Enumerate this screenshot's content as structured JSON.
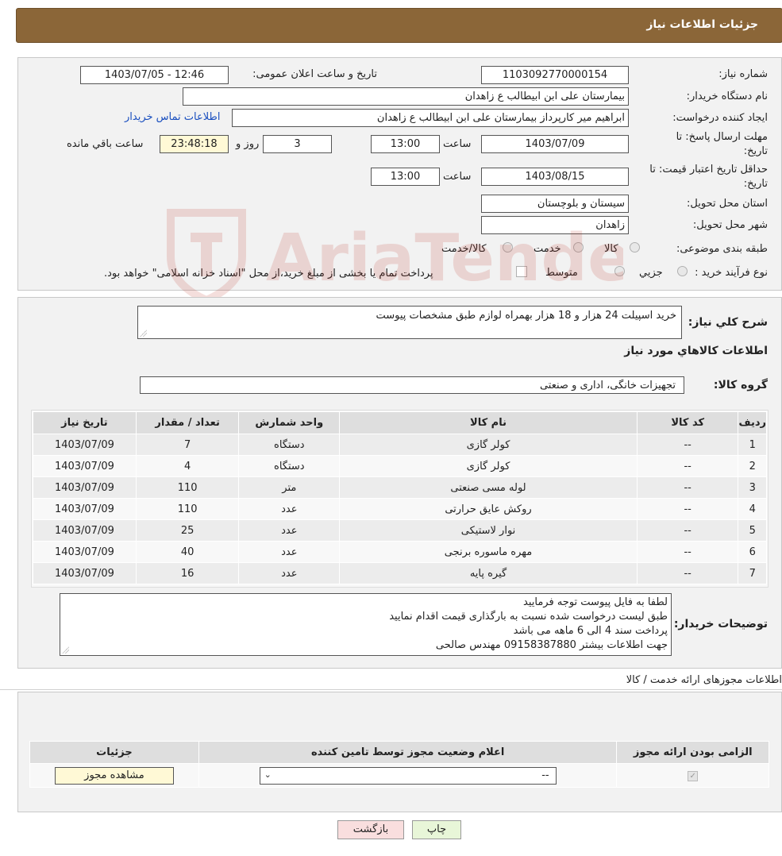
{
  "header": {
    "title": "جزئیات اطلاعات نیاز"
  },
  "need": {
    "number_label": "شماره نیاز:",
    "number_value": "1103092770000154",
    "announce_label": "تاریخ و ساعت اعلان عمومی:",
    "announce_value": "1403/07/05 - 12:46",
    "buyer_label": "نام دستگاه خریدار:",
    "buyer_value": "بیمارستان علی ابن ابیطالب  ع  زاهدان",
    "creator_label": "ایجاد کننده درخواست:",
    "creator_value": "ابراهیم میر کارپرداز بیمارستان علی ابن ابیطالب  ع  زاهدان",
    "contact_link": "اطلاعات تماس خریدار",
    "deadline_label_1": "مهلت ارسال پاسخ: تا",
    "deadline_label_2": "تاریخ:",
    "deadline_date": "1403/07/09",
    "time_label": "ساعت",
    "deadline_time": "13:00",
    "days_value": "3",
    "days_label": "روز و",
    "remaining_value": "23:48:18",
    "remaining_label": "ساعت باقي مانده",
    "validity_label_1": "حداقل تاریخ اعتبار قیمت: تا",
    "validity_label_2": "تاریخ:",
    "validity_date": "1403/08/15",
    "validity_time": "13:00",
    "province_label": "استان محل تحویل:",
    "province_value": "سیستان و بلوچستان",
    "city_label": "شهر محل تحویل:",
    "city_value": "زاهدان",
    "category_label": "طبقه بندی موضوعی:",
    "category_options": [
      "کالا",
      "خدمت",
      "کالا/خدمت"
    ],
    "process_label": "نوع فرآیند خرید :",
    "process_options": [
      "جزیي",
      "متوسط"
    ],
    "process_note": "پرداخت تمام یا بخشی از مبلغ خرید،از محل \"اسناد خزانه اسلامی\" خواهد بود."
  },
  "description": {
    "label": "شرح کلي نياز:",
    "value": "خرید اسپیلت 24 هزار و 18 هزار بهمراه لوازم طبق مشخصات پیوست"
  },
  "goods_title": "اطلاعات کالاهاي مورد نياز",
  "group": {
    "label": "گروه کالا:",
    "value": "تجهیزات خانگی، اداری و صنعتی"
  },
  "goods_table": {
    "headers": [
      "رديف",
      "کد کالا",
      "نام کالا",
      "واحد شمارش",
      "تعداد / مقدار",
      "تاریخ نیاز"
    ],
    "rows": [
      [
        "1",
        "--",
        "کولر گازی",
        "دستگاه",
        "7",
        "1403/07/09"
      ],
      [
        "2",
        "--",
        "کولر گازی",
        "دستگاه",
        "4",
        "1403/07/09"
      ],
      [
        "3",
        "--",
        "لوله مسی صنعتی",
        "متر",
        "110",
        "1403/07/09"
      ],
      [
        "4",
        "--",
        "روکش عایق حرارتی",
        "عدد",
        "110",
        "1403/07/09"
      ],
      [
        "5",
        "--",
        "نوار لاستیکی",
        "عدد",
        "25",
        "1403/07/09"
      ],
      [
        "6",
        "--",
        "مهره ماسوره برنجی",
        "عدد",
        "40",
        "1403/07/09"
      ],
      [
        "7",
        "--",
        "گیره پایه",
        "عدد",
        "16",
        "1403/07/09"
      ]
    ]
  },
  "buyer_notes": {
    "label": "توضیحات خریدار:",
    "lines": [
      "لطفا به فایل پیوست توجه فرمایید",
      "طبق لیست درخواست شده نسبت به بارگذاری قیمت اقدام نمایید",
      "پرداخت سند 4 الی 6 ماهه می باشد",
      "جهت اطلاعات بیشتر 09158387880 مهندس صالحی"
    ]
  },
  "permits": {
    "title": "اطلاعات مجوزهای ارائه خدمت / کالا",
    "headers": [
      "الزامی بودن ارائه مجوز",
      "اعلام وضعیت مجوز توسط تامین کننده",
      "جزئیات"
    ],
    "select_value": "--",
    "view_button": "مشاهده مجوز"
  },
  "actions": {
    "print": "چاپ",
    "back": "بازگشت"
  },
  "watermark": {
    "text": "AriaTender.neT"
  },
  "colors": {
    "header_bg": "#8b6638",
    "link": "#1a4fbf",
    "watermark": "#c0392b"
  }
}
